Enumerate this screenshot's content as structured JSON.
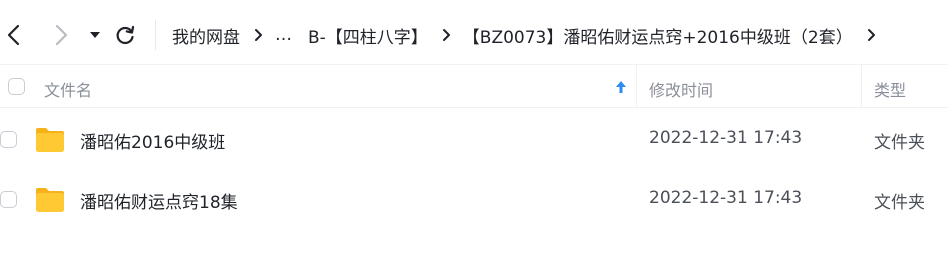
{
  "nav": {
    "back_icon": "chevron-left-icon",
    "forward_icon": "chevron-right-icon",
    "dropdown_icon": "caret-down-icon",
    "refresh_icon": "refresh-icon"
  },
  "breadcrumb": {
    "items": [
      "我的网盘",
      "…",
      "B-【四柱八字】",
      "【BZ0073】潘昭佑财运点窍+2016中级班（2套）"
    ]
  },
  "table": {
    "columns": {
      "name": "文件名",
      "modified": "修改时间",
      "type": "类型"
    },
    "sort_icon": "arrow-up-icon",
    "rows": [
      {
        "name": "潘昭佑2016中级班",
        "modified": "2022-12-31 17:43",
        "type": "文件夹",
        "icon": "folder-icon"
      },
      {
        "name": "潘昭佑财运点窍18集",
        "modified": "2022-12-31 17:43",
        "type": "文件夹",
        "icon": "folder-icon"
      }
    ]
  },
  "colors": {
    "folder": "#FFC933",
    "folder_dark": "#F5B21A",
    "sort_arrow": "#2E8CF0"
  }
}
